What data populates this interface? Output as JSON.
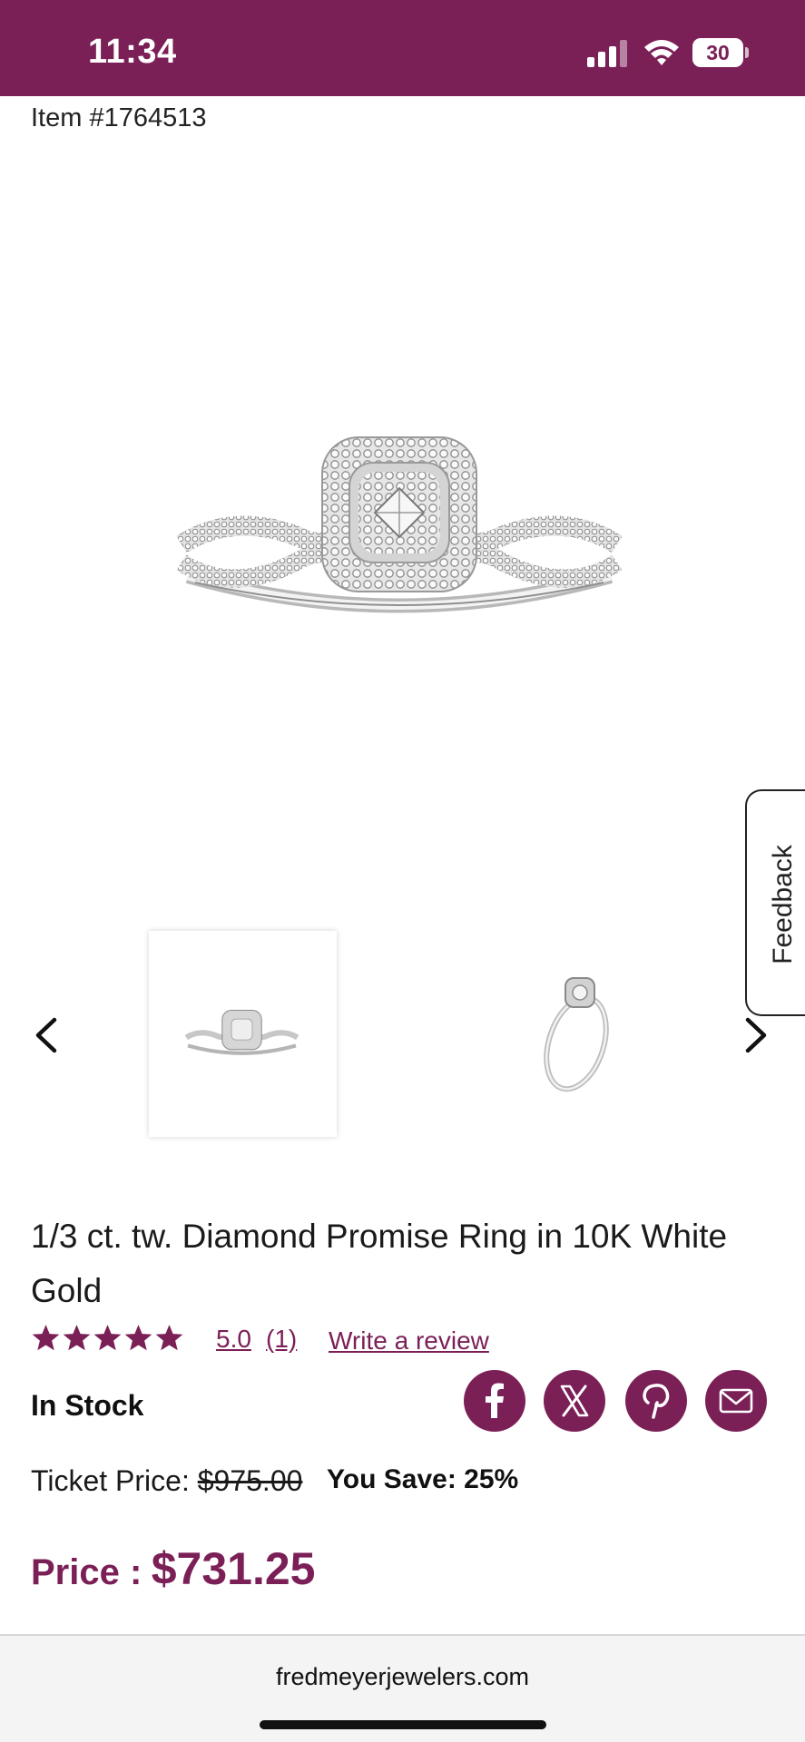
{
  "status_bar": {
    "time": "11:34",
    "battery": "30"
  },
  "item": {
    "number": "Item #1764513"
  },
  "feedback": {
    "label": "Feedback"
  },
  "product": {
    "title": "1/3 ct. tw. Diamond Promise Ring in 10K White Gold",
    "rating_value": "5.0",
    "rating_count": "(1)",
    "star_count": 5,
    "write_review": "Write a review",
    "stock": "In Stock"
  },
  "pricing": {
    "ticket_label": "Ticket Price: ",
    "ticket_price": "$975.00",
    "you_save_label": "You Save:",
    "you_save_value": "25%",
    "price_label": "Price :",
    "price_value": "$731.25"
  },
  "browser": {
    "url": "fredmeyerjewelers.com"
  },
  "colors": {
    "brand": "#7b1f57",
    "white": "#ffffff"
  },
  "icons": [
    "signal-icon",
    "wifi-icon",
    "battery-icon",
    "chevron-left-icon",
    "chevron-right-icon",
    "star-icon",
    "facebook-icon",
    "x-icon",
    "pinterest-icon",
    "mail-icon"
  ]
}
